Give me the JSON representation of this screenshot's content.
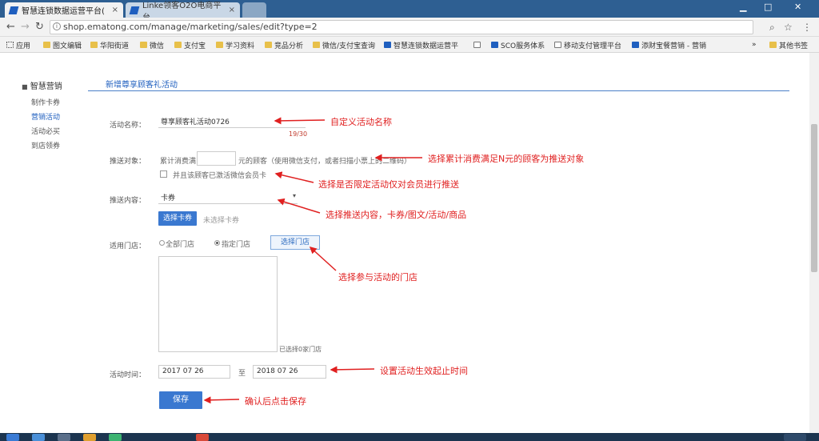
{
  "browser": {
    "tabs": [
      {
        "label": "智慧连锁数据运营平台(",
        "close": "×"
      },
      {
        "label": "Linke领客O2O电商平台",
        "close": "×"
      }
    ],
    "url": "shop.ematong.com/manage/marketing/sales/edit?type=2",
    "bookmarks": [
      "应用",
      "图文编辑",
      "华阳街道",
      "微信",
      "支付宝",
      "学习资料",
      "竞品分析",
      "微信/支付宝查询",
      "智慧连锁数据运营平",
      "SCO服务体系",
      "移动支付管理平台",
      "添财宝餐营销 - 营销",
      "其他书签"
    ],
    "more": "»"
  },
  "sidebar": {
    "title": "智慧营销",
    "items": [
      "制作卡券",
      "营销活动",
      "活动必买",
      "到店领券"
    ]
  },
  "page": {
    "tab": "新增尊享顾客礼活动"
  },
  "form": {
    "name_label": "活动名称：",
    "name_value": "尊享顾客礼活动0726",
    "name_counter": "19/30",
    "target_label": "推送对象：",
    "target_prefix": "累计消费满",
    "target_suffix": "元的顾客（使用微信支付，或者扫描小票上的二维码）",
    "member_checkbox_label": "并且该顾客已激活微信会员卡",
    "content_label": "推送内容：",
    "content_value": "卡券",
    "select_coupon_button": "选择卡券",
    "no_coupon_text": "未选择卡券",
    "store_label": "适用门店：",
    "store_all": "全部门店",
    "store_specific": "指定门店",
    "select_store_button": "选择门店",
    "selected_store_count": "已选择0家门店",
    "time_label": "活动时间：",
    "start_date": "2017 07 26",
    "date_sep": "至",
    "end_date": "2018 07 26",
    "save_button": "保存"
  },
  "annotations": [
    "自定义活动名称",
    "选择累计消费满足N元的顾客为推送对象",
    "选择是否限定活动仅对会员进行推送",
    "选择推送内容，卡券/图文/活动/商品",
    "选择参与活动的门店",
    "设置活动生效起止时间",
    "确认后点击保存"
  ],
  "colors": {
    "accent": "#3a78d0",
    "annotation": "#e02020",
    "tabbar": "#2e5f92"
  }
}
